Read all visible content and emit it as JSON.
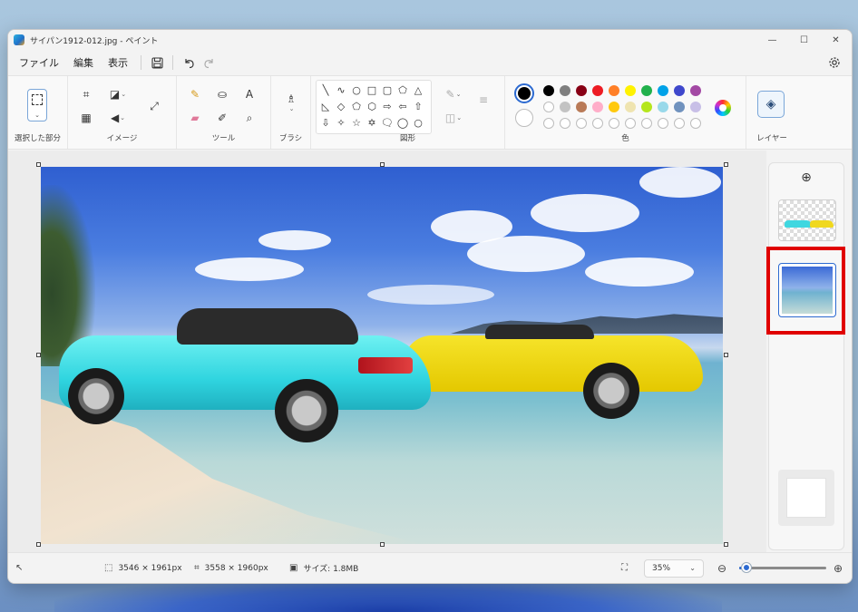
{
  "window": {
    "title": "サイパン1912-012.jpg - ペイント",
    "controls": {
      "minimize": "—",
      "maximize": "☐",
      "close": "✕"
    }
  },
  "menu": {
    "items": [
      "ファイル",
      "編集",
      "表示"
    ],
    "save_icon": "save-icon",
    "undo_icon": "undo-icon",
    "redo_icon": "redo-icon",
    "settings_icon": "gear-icon"
  },
  "ribbon": {
    "groups": {
      "selection": "選択した部分",
      "image": "イメージ",
      "tools": "ツール",
      "brushes": "ブラシ",
      "shapes": "図形",
      "colors": "色",
      "layers": "レイヤー"
    },
    "palette_row1": [
      "#000000",
      "#7f7f7f",
      "#880015",
      "#ed1c24",
      "#ff7f27",
      "#fff200",
      "#22b14c",
      "#00a2e8",
      "#3f48cc",
      "#a349a4"
    ],
    "palette_row2": [
      "#ffffff",
      "#c3c3c3",
      "#b97a57",
      "#ffaec9",
      "#ffc90e",
      "#efe4b0",
      "#b5e61d",
      "#99d9ea",
      "#7092be",
      "#c8bfe7"
    ],
    "palette_row3_empty": 10,
    "primary_color": "#000000",
    "secondary_color": "#ffffff"
  },
  "status": {
    "selection_size": "3546 × 1961px",
    "image_size": "3558 × 1960px",
    "file_size": "サイズ: 1.8MB",
    "zoom": "35%",
    "zoom_level": 0.08
  },
  "layers": {
    "add_icon": "plus-circle-icon",
    "count": 2,
    "selected": "background-layer"
  },
  "colors": {
    "accent": "#2c6ad1",
    "highlight": "#e00000"
  }
}
